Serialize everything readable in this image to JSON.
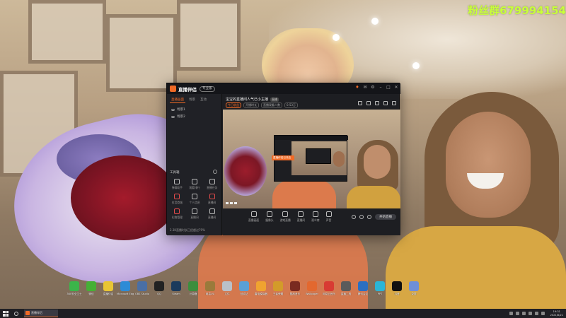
{
  "watermark": "粉丝群679994154",
  "app": {
    "brand": "直播伴侣",
    "version_badge": "专业版",
    "sidebar": {
      "tabs": [
        "直播画面",
        "场景",
        "互动"
      ],
      "scenes": [
        "场景1",
        "场景2"
      ],
      "tools_title": "工具箱",
      "tools": [
        "弹幕助手",
        "观看排行",
        "直播任务",
        "抖音商城",
        "个人信息",
        "直播间",
        "礼物管理",
        "直播间",
        "直播间"
      ],
      "footer": "2.3K直播时长已经超过79%"
    },
    "main": {
      "room_title": "宝宝的直播间人气已小主播",
      "room_pill": "直播",
      "meta": [
        "今日收益",
        "开播时长",
        "直播观看人数",
        "0.53万"
      ],
      "bottom_tools": [
        "直播画面",
        "摄像头",
        "游戏直播",
        "直播间",
        "观众席",
        "声音"
      ],
      "go_live_label": "开始直播",
      "inner_bar_label": "直播伴侣已开启"
    },
    "colors": {
      "accent": "#f06a26",
      "window_bg": "#1d1e22"
    }
  },
  "desktop": {
    "icons": [
      {
        "label": "360安全卫士",
        "color": "#3bb54a"
      },
      {
        "label": "微信",
        "color": "#45b035"
      },
      {
        "label": "直播伴侣",
        "color": "#e8c534"
      },
      {
        "label": "Microsoft Edge",
        "color": "#2e8bd6"
      },
      {
        "label": "OBS Studio",
        "color": "#4a6fa5"
      },
      {
        "label": "QQ",
        "color": "#222"
      },
      {
        "label": "Steam",
        "color": "#1b3a5c"
      },
      {
        "label": "计算器",
        "color": "#3b8e3d"
      },
      {
        "label": "网易UU",
        "color": "#9a7a3b"
      },
      {
        "label": "文件",
        "color": "#b9c0c8"
      },
      {
        "label": "回收站",
        "color": "#5aa0d6"
      },
      {
        "label": "雷电模拟器",
        "color": "#f0a330"
      },
      {
        "label": "王者荣耀",
        "color": "#d39b2a"
      },
      {
        "label": "酷狗音乐",
        "color": "#7a2a20"
      },
      {
        "label": "Wallpaper",
        "color": "#e3682f"
      },
      {
        "label": "网易云音乐",
        "color": "#d83b33"
      },
      {
        "label": "直播工具",
        "color": "#5b5b5b"
      },
      {
        "label": "腾讯会议",
        "color": "#2b6fc2"
      },
      {
        "label": "PPT",
        "color": "#2bb5d6"
      },
      {
        "label": "抖音",
        "color": "#111"
      },
      {
        "label": "录屏",
        "color": "#6f8fd8"
      }
    ]
  },
  "taskbar": {
    "active_app": "直播伴侣",
    "time": "19:31",
    "date": "2021/8/21"
  }
}
